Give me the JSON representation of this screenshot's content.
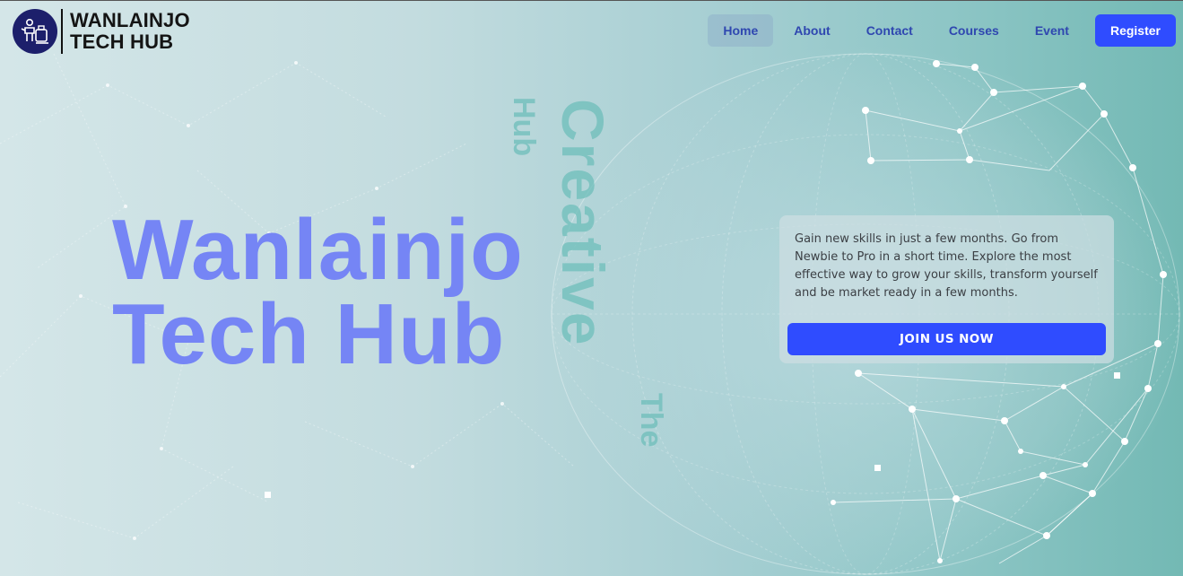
{
  "logo": {
    "line1": "WANLAINJO",
    "line2": "TECH HUB"
  },
  "nav": {
    "items": [
      {
        "label": "Home",
        "active": true
      },
      {
        "label": "About"
      },
      {
        "label": "Contact"
      },
      {
        "label": "Courses"
      },
      {
        "label": "Event"
      }
    ],
    "register_label": "Register"
  },
  "hero": {
    "title_line1": "Wanlainjo",
    "title_line2": "Tech Hub",
    "vertical_creative": "Creative",
    "vertical_hub": "Hub",
    "vertical_the": "The"
  },
  "card": {
    "text": "Gain new skills in just a few months. Go from Newbie to Pro in a short time. Explore the most effective way to grow your skills, transform yourself and be market ready in a few months.",
    "button_label": "JOIN US NOW"
  },
  "colors": {
    "accent": "#2f4cff",
    "nav_text": "#2f47b0",
    "title": "#7585f5",
    "logo_badge": "#1c1f6b",
    "teal": "#73b9b4"
  }
}
